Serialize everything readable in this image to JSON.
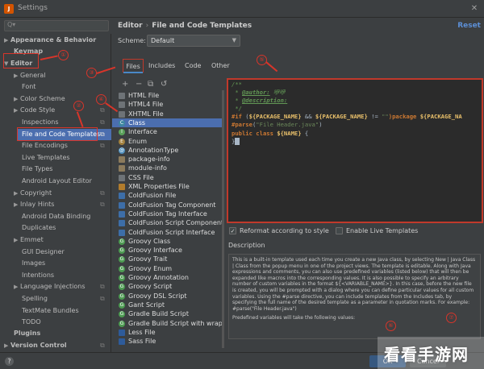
{
  "window": {
    "title": "Settings",
    "app_icon_letter": "J",
    "close_glyph": "✕"
  },
  "search": {
    "placeholder": "Q▾"
  },
  "sidebar": {
    "items": [
      {
        "label": "Appearance & Behavior",
        "arrow": "▶"
      },
      {
        "label": "Keymap"
      },
      {
        "label": "Editor",
        "arrow": "▼"
      },
      {
        "label": "General",
        "arrow": "▶"
      },
      {
        "label": "Font"
      },
      {
        "label": "Color Scheme",
        "arrow": "▶"
      },
      {
        "label": "Code Style",
        "arrow": "▶"
      },
      {
        "label": "Inspections"
      },
      {
        "label": "File and Code Templates"
      },
      {
        "label": "File Encodings"
      },
      {
        "label": "Live Templates"
      },
      {
        "label": "File Types"
      },
      {
        "label": "Android Layout Editor"
      },
      {
        "label": "Copyright",
        "arrow": "▶"
      },
      {
        "label": "Inlay Hints",
        "arrow": "▶"
      },
      {
        "label": "Android Data Binding"
      },
      {
        "label": "Duplicates"
      },
      {
        "label": "Emmet",
        "arrow": "▶"
      },
      {
        "label": "GUI Designer"
      },
      {
        "label": "Images"
      },
      {
        "label": "Intentions"
      },
      {
        "label": "Language Injections",
        "arrow": "▶"
      },
      {
        "label": "Spelling"
      },
      {
        "label": "TextMate Bundles"
      },
      {
        "label": "TODO"
      },
      {
        "label": "Plugins"
      },
      {
        "label": "Version Control",
        "arrow": "▶"
      }
    ],
    "copy_glyph": "⧉"
  },
  "main": {
    "breadcrumb": {
      "parent": "Editor",
      "sep": "›",
      "current": "File and Code Templates"
    },
    "reset_label": "Reset",
    "scheme_label": "Scheme:",
    "scheme_value": "Default",
    "scheme_chevron": "▼",
    "tabs": [
      "Files",
      "Includes",
      "Code",
      "Other"
    ],
    "toolbar": {
      "add": "+",
      "remove": "−",
      "copy": "⧉",
      "reset": "↺"
    }
  },
  "templates": [
    {
      "label": "HTML File",
      "icon": "doc"
    },
    {
      "label": "HTML4 File",
      "icon": "doc"
    },
    {
      "label": "XHTML File",
      "icon": "doc"
    },
    {
      "label": "Class",
      "icon": "class"
    },
    {
      "label": "Interface",
      "icon": "iface"
    },
    {
      "label": "Enum",
      "icon": "enum"
    },
    {
      "label": "AnnotationType",
      "icon": "anno"
    },
    {
      "label": "package-info",
      "icon": "pkg"
    },
    {
      "label": "module-info",
      "icon": "pkg"
    },
    {
      "label": "CSS File",
      "icon": "doc"
    },
    {
      "label": "XML Properties File",
      "icon": "xml"
    },
    {
      "label": "ColdFusion File",
      "icon": "cf"
    },
    {
      "label": "ColdFusion Tag Component",
      "icon": "cf"
    },
    {
      "label": "ColdFusion Tag Interface",
      "icon": "cf"
    },
    {
      "label": "ColdFusion Script Component",
      "icon": "cf"
    },
    {
      "label": "ColdFusion Script Interface",
      "icon": "cf"
    },
    {
      "label": "Groovy Class",
      "icon": "groovy"
    },
    {
      "label": "Groovy Interface",
      "icon": "groovy"
    },
    {
      "label": "Groovy Trait",
      "icon": "groovy"
    },
    {
      "label": "Groovy Enum",
      "icon": "groovy"
    },
    {
      "label": "Groovy Annotation",
      "icon": "groovy"
    },
    {
      "label": "Groovy Script",
      "icon": "groovy"
    },
    {
      "label": "Groovy DSL Script",
      "icon": "groovy"
    },
    {
      "label": "Gant Script",
      "icon": "groovy"
    },
    {
      "label": "Gradle Build Script",
      "icon": "groovy"
    },
    {
      "label": "Gradle Build Script with wrapper",
      "icon": "groovy"
    },
    {
      "label": "Less File",
      "icon": "less"
    },
    {
      "label": "Sass File",
      "icon": "less"
    }
  ],
  "editor": {
    "line1": "/**",
    "line2_prefix": " * ",
    "line2_tag": "@author:",
    "line2_val": " 咿咿",
    "line3_prefix": " * ",
    "line3_tag": "@description:",
    "line4": " */",
    "line5_kw": "#if",
    "line5_a": " (",
    "line5_v1": "${PACKAGE_NAME}",
    "line5_b": " && ",
    "line5_v2": "${PACKAGE_NAME}",
    "line5_c": " != ",
    "line5_str": "\"\"",
    "line5_d": ")package ",
    "line5_v3": "${PACKAGE_NA",
    "line6_kw": "#parse",
    "line6_a": "(",
    "line6_str": "\"File Header.java\"",
    "line6_b": ")",
    "line7_a": "public class ",
    "line7_v": "${NAME}",
    "line7_b": " {",
    "line8": "}"
  },
  "options": {
    "reformat_label": "Reformat according to style",
    "reformat_check": "✓",
    "live_label": "Enable Live Templates"
  },
  "description": {
    "label": "Description",
    "text": "This is a built-in template used each time you create a new Java class, by selecting New | Java Class | Class from the popup menu in one of the project views. The template is editable. Along with Java expressions and comments, you can also use predefined variables (listed below) that will then be expanded like macros into the corresponding values. It is also possible to specify an arbitrary number of custom variables in the format ${<VARIABLE_NAME>}. In this case, before the new file is created, you will be prompted with a dialog where you can define particular values for all custom variables. Using the #parse directive, you can include templates from the Includes tab, by specifying the full name of the desired template as a parameter in quotation marks. For example: #parse(\"File Header.java\")",
    "text2": "Predefined variables will take the following values:"
  },
  "annotations": [
    "①",
    "②",
    "③",
    "④",
    "⑤",
    "⑥",
    "⑦"
  ],
  "footer": {
    "help": "?",
    "ok": "OK",
    "cancel": "Cancel"
  },
  "watermark": "看看手游网",
  "colors": {
    "accent_red": "#d8352a",
    "selection": "#4b6eaf",
    "link": "#5c8fd6"
  }
}
